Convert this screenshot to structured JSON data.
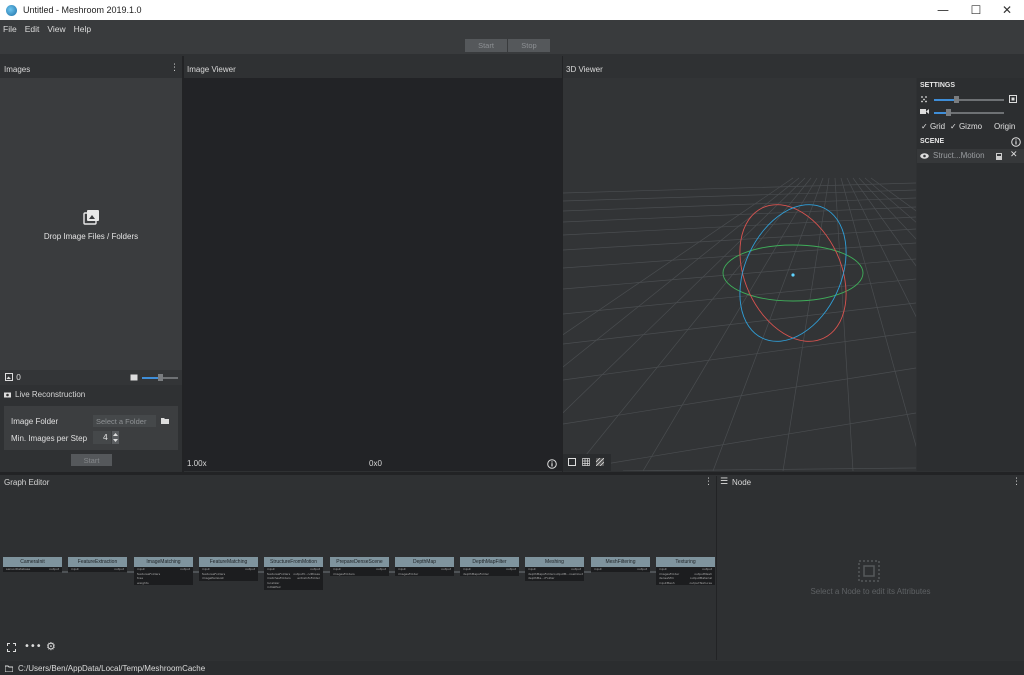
{
  "window": {
    "title": "Untitled - Meshroom 2019.1.0",
    "minimize": "—",
    "maximize": "☐",
    "close": "✕"
  },
  "menu": [
    "File",
    "Edit",
    "View",
    "Help"
  ],
  "toolbar": {
    "start_label": "Start",
    "stop_label": "Stop"
  },
  "images_panel": {
    "title": "Images",
    "drop_text": "Drop Image Files / Folders",
    "count": "0",
    "live": {
      "title": "Live Reconstruction",
      "folder_label": "Image Folder",
      "folder_placeholder": "Select a Folder",
      "min_images_label": "Min. Images per Step",
      "min_images_value": "4",
      "start_label": "Start"
    }
  },
  "image_viewer": {
    "title": "Image Viewer",
    "zoom": "1.00x",
    "resolution": "0x0"
  },
  "viewer_3d": {
    "title": "3D Viewer",
    "settings_title": "SETTINGS",
    "options": [
      "Grid",
      "Gizmo",
      "Origin"
    ],
    "scene_title": "SCENE",
    "scene_item": "Struct...Motion"
  },
  "graph_editor": {
    "title": "Graph Editor",
    "nodes": [
      {
        "name": "CameraInit",
        "inputs": [
          "sensorDatabase"
        ],
        "outputs": [
          "output"
        ]
      },
      {
        "name": "FeatureExtraction",
        "inputs": [
          "input"
        ],
        "outputs": [
          "output"
        ]
      },
      {
        "name": "ImageMatching",
        "inputs": [
          "input",
          "featuresFolders",
          "tree",
          "weights"
        ],
        "outputs": [
          "output"
        ]
      },
      {
        "name": "FeatureMatching",
        "inputs": [
          "input",
          "featuresFolders",
          "imagePairsList"
        ],
        "outputs": [
          "output"
        ]
      },
      {
        "name": "StructureFromMotion",
        "inputs": [
          "input",
          "featuresFolders",
          "matchesFolders",
          "localizer",
          "initialPair"
        ],
        "outputs": [
          "output",
          "outputV...ndPoses",
          "extraInfoFolder"
        ]
      },
      {
        "name": "PrepareDenseScene",
        "inputs": [
          "input",
          "imagesFolders"
        ],
        "outputs": [
          "output"
        ]
      },
      {
        "name": "DepthMap",
        "inputs": [
          "input",
          "imagesFolder"
        ],
        "outputs": [
          "output"
        ]
      },
      {
        "name": "DepthMapFilter",
        "inputs": [
          "input",
          "depthMapsFolder"
        ],
        "outputs": [
          "output"
        ]
      },
      {
        "name": "Meshing",
        "inputs": [
          "input",
          "depthMapsFolder",
          "depthMa...rFolder"
        ],
        "outputs": [
          "output",
          "outputM...nseCloud"
        ]
      },
      {
        "name": "MeshFiltering",
        "inputs": [
          "input"
        ],
        "outputs": [
          "output"
        ]
      },
      {
        "name": "Texturing",
        "inputs": [
          "input",
          "imagesFolder",
          "denseSfm",
          "inputMesh"
        ],
        "outputs": [
          "output",
          "outputMesh",
          "outputMaterial",
          "outputTextures"
        ]
      }
    ]
  },
  "node_panel": {
    "title": "Node",
    "placeholder": "Select a Node to edit its Attributes"
  },
  "status": {
    "path": "C:/Users/Ben/AppData/Local/Temp/MeshroomCache"
  },
  "colors": {
    "accent": "#3f8ed8",
    "node_header": "#7f949e",
    "gizmo_red": "#d9534f",
    "gizmo_green": "#3fae5a",
    "gizmo_blue": "#2f9fd8"
  }
}
